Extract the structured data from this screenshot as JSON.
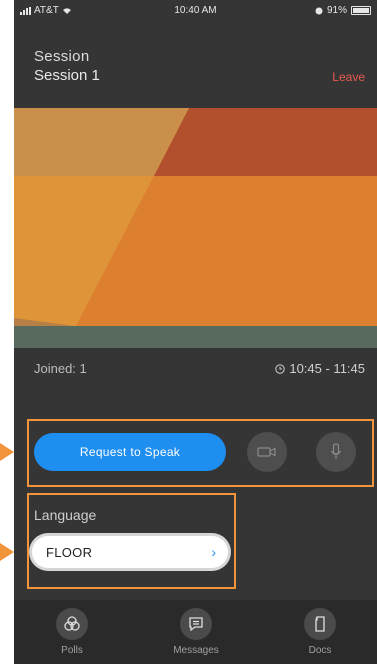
{
  "status_bar": {
    "carrier": "AT&T",
    "time": "10:40 AM",
    "battery": "91%"
  },
  "header": {
    "session_label": "Session",
    "session_name": "Session 1",
    "leave_label": "Leave"
  },
  "info": {
    "joined": "Joined: 1",
    "time_range": "10:45 - 11:45"
  },
  "controls": {
    "request_label": "Request to Speak"
  },
  "language": {
    "label": "Language",
    "selected": "FLOOR"
  },
  "tabs": [
    {
      "label": "Polls",
      "icon": "polls-icon"
    },
    {
      "label": "Messages",
      "icon": "messages-icon"
    },
    {
      "label": "Docs",
      "icon": "docs-icon"
    }
  ],
  "colors": {
    "accent": "#1f8ef1",
    "leave": "#e85a4f",
    "annotation": "#f2953a",
    "background": "#353535"
  }
}
